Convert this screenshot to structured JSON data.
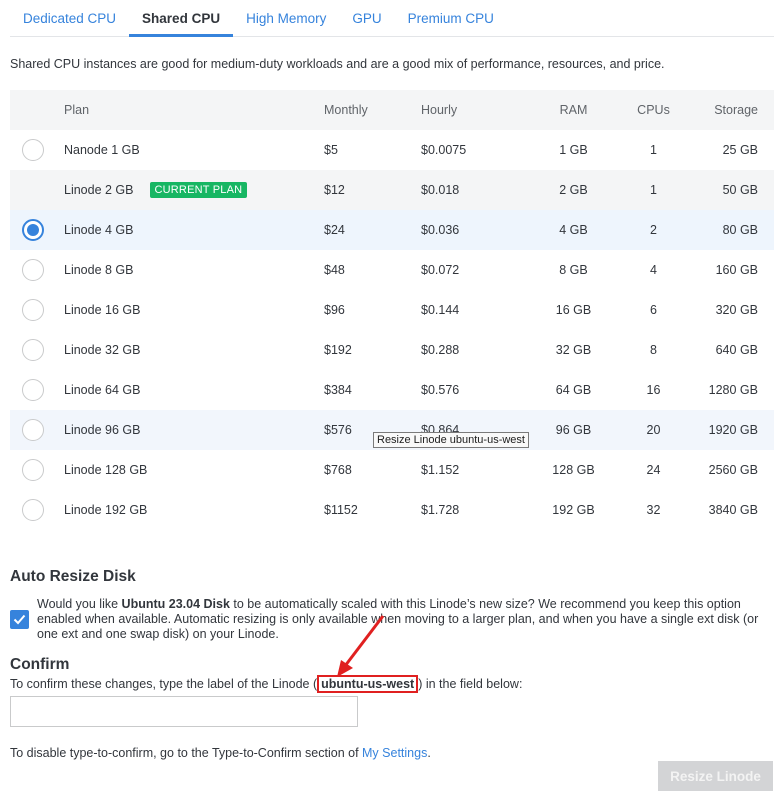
{
  "tabs": [
    "Dedicated CPU",
    "Shared CPU",
    "High Memory",
    "GPU",
    "Premium CPU"
  ],
  "description": "Shared CPU instances are good for medium-duty workloads and are a good mix of performance, resources, and price.",
  "table": {
    "headers": {
      "plan": "Plan",
      "monthly": "Monthly",
      "hourly": "Hourly",
      "ram": "RAM",
      "cpus": "CPUs",
      "storage": "Storage"
    },
    "current_badge": "CURRENT PLAN",
    "rows": [
      {
        "plan": "Nanode 1 GB",
        "monthly": "$5",
        "hourly": "$0.0075",
        "ram": "1 GB",
        "cpus": "1",
        "storage": "25 GB"
      },
      {
        "plan": "Linode 2 GB",
        "monthly": "$12",
        "hourly": "$0.018",
        "ram": "2 GB",
        "cpus": "1",
        "storage": "50 GB"
      },
      {
        "plan": "Linode 4 GB",
        "monthly": "$24",
        "hourly": "$0.036",
        "ram": "4 GB",
        "cpus": "2",
        "storage": "80 GB"
      },
      {
        "plan": "Linode 8 GB",
        "monthly": "$48",
        "hourly": "$0.072",
        "ram": "8 GB",
        "cpus": "4",
        "storage": "160 GB"
      },
      {
        "plan": "Linode 16 GB",
        "monthly": "$96",
        "hourly": "$0.144",
        "ram": "16 GB",
        "cpus": "6",
        "storage": "320 GB"
      },
      {
        "plan": "Linode 32 GB",
        "monthly": "$192",
        "hourly": "$0.288",
        "ram": "32 GB",
        "cpus": "8",
        "storage": "640 GB"
      },
      {
        "plan": "Linode 64 GB",
        "monthly": "$384",
        "hourly": "$0.576",
        "ram": "64 GB",
        "cpus": "16",
        "storage": "1280 GB"
      },
      {
        "plan": "Linode 96 GB",
        "monthly": "$576",
        "hourly": "$0.864",
        "ram": "96 GB",
        "cpus": "20",
        "storage": "1920 GB"
      },
      {
        "plan": "Linode 128 GB",
        "monthly": "$768",
        "hourly": "$1.152",
        "ram": "128 GB",
        "cpus": "24",
        "storage": "2560 GB"
      },
      {
        "plan": "Linode 192 GB",
        "monthly": "$1152",
        "hourly": "$1.728",
        "ram": "192 GB",
        "cpus": "32",
        "storage": "3840 GB"
      }
    ]
  },
  "tooltip": "Resize Linode ubuntu-us-west",
  "auto_resize": {
    "heading": "Auto Resize Disk",
    "checked": true,
    "text_before": "Would you like ",
    "disk_name": "Ubuntu 23.04 Disk",
    "text_after": " to be automatically scaled with this Linode’s new size? We recommend you keep this option enabled when available. Automatic resizing is only available when moving to a larger plan, and when you have a single ext disk (or one ext and one swap disk) on your Linode."
  },
  "confirm": {
    "heading": "Confirm",
    "text_before": "To confirm these changes, type the label of the Linode (",
    "label": "ubuntu-us-west",
    "text_after": ") in the field below:",
    "input_value": ""
  },
  "settings_note": {
    "text": "To disable type-to-confirm, go to the Type-to-Confirm section of ",
    "link": "My Settings",
    "end": "."
  },
  "resize_button": "Resize Linode",
  "colors": {
    "accent": "#3683dc",
    "badge": "#17b663",
    "annotation": "#e02020",
    "disabled_button": "#d3d4d6"
  }
}
